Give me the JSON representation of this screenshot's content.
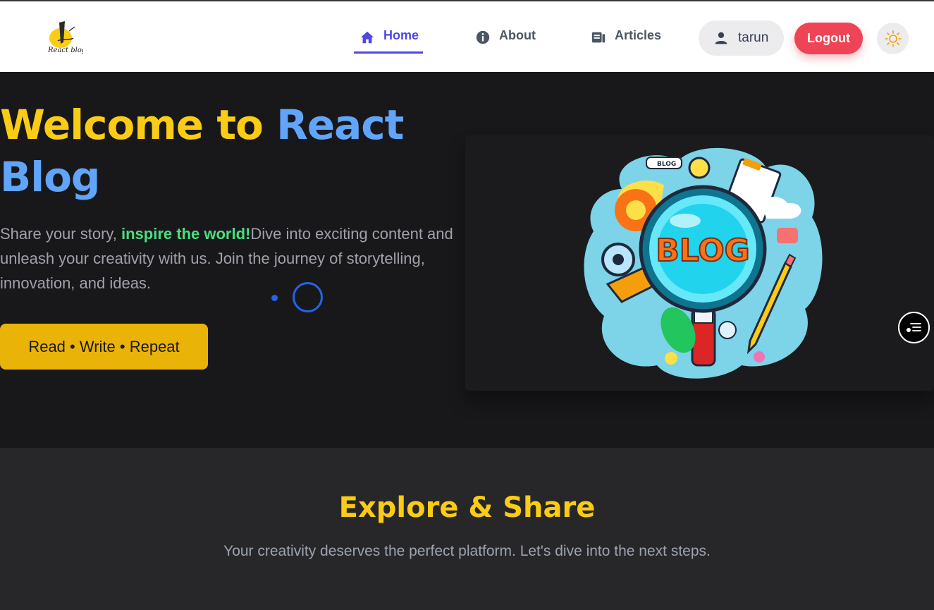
{
  "brand": {
    "logo_text": "React blog"
  },
  "nav": {
    "home": "Home",
    "about": "About",
    "articles": "Articles"
  },
  "user": {
    "name": "tarun",
    "logout_label": "Logout"
  },
  "hero": {
    "title_welcome": "Welcome to ",
    "title_react": "React",
    "title_blog": "Blog",
    "desc_start": "Share your story, ",
    "desc_highlight": "inspire the world!",
    "desc_end": "Dive into exciting content and unleash your creativity with us. Join the journey of storytelling, innovation, and ideas.",
    "cta_label": "Read • Write • Repeat",
    "image_text": "BLOG",
    "badge_text": "BLOG"
  },
  "section": {
    "title": "Explore & Share",
    "subtitle": "Your creativity deserves the perfect platform. Let's dive into the next steps."
  },
  "colors": {
    "accent_yellow": "#facc15",
    "accent_blue": "#60a5fa",
    "accent_green": "#4ade80",
    "nav_active": "#4f46e5",
    "logout_red": "#ef4455",
    "cta_yellow": "#eab308"
  },
  "icons": {
    "home": "home-icon",
    "about": "info-icon",
    "articles": "article-icon",
    "user": "user-icon",
    "theme": "sun-icon",
    "fab": "filter-list-icon"
  }
}
